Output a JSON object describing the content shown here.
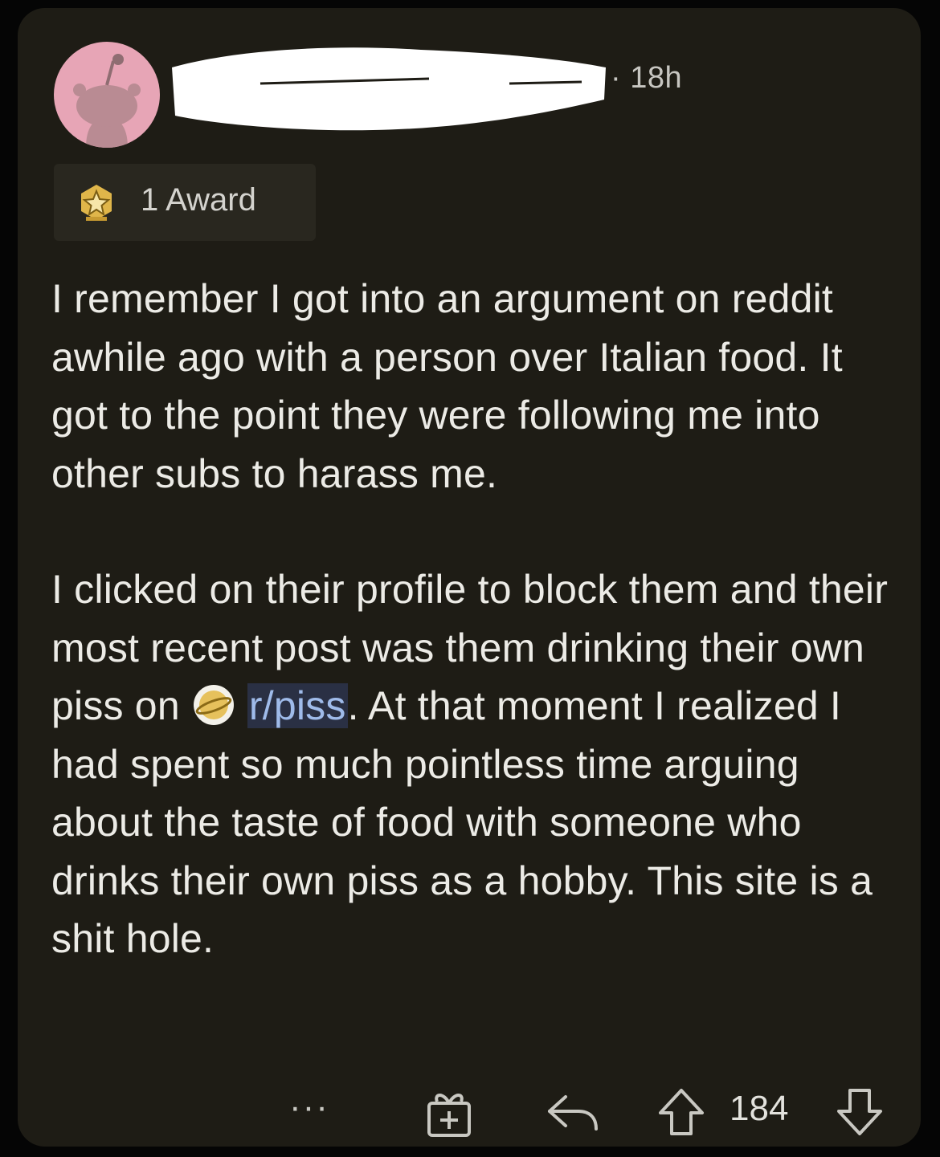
{
  "comment": {
    "timestamp": "· 18h",
    "awards_label": "1 Award",
    "paragraph1": "I remember I got into an argument on reddit awhile ago with a person over Italian food. It got to the point they were following me into other subs to harass me.",
    "paragraph2_before": "I clicked on their profile to block them and their most recent post was them drinking their own piss on",
    "subreddit_link": "r/piss",
    "paragraph2_after": ". At that moment I realized I had spent so much pointless time arguing about the taste of food with someone who drinks their own piss as a hobby. This site is a shit hole."
  },
  "actions": {
    "more": "···",
    "score": "184"
  },
  "icons": {
    "avatar": "snoo-avatar-icon",
    "award": "award-badge-icon",
    "subreddit": "planet-icon",
    "gift": "gift-icon",
    "reply": "reply-icon",
    "upvote": "upvote-icon",
    "downvote": "downvote-icon"
  },
  "colors": {
    "card_background": "#1e1c15",
    "avatar_background": "#e7a5b6",
    "link": "#9fbbea",
    "text": "#ecebe6"
  }
}
